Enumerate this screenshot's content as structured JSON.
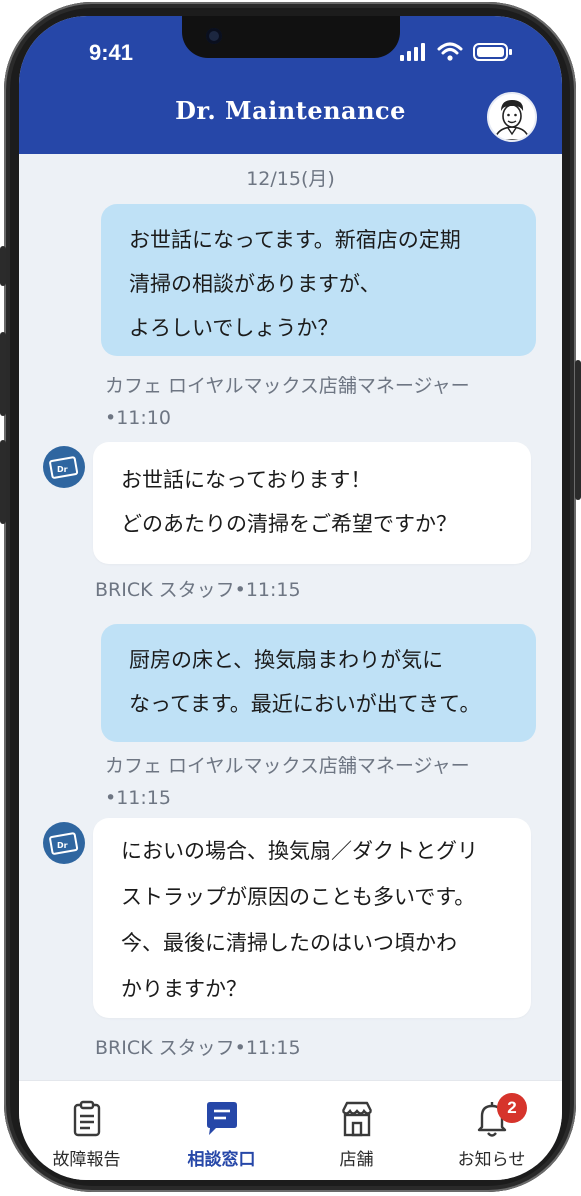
{
  "status_bar": {
    "time": "9:41"
  },
  "header": {
    "app_title": "Dr. Maintenance"
  },
  "chat": {
    "date": "12/15(月)",
    "messages": [
      {
        "direction": "out",
        "text": "お世話になってます。新宿店の定期\n清掃の相談がありますが、\nよろしいでしょうか？",
        "meta": "カフェ ロイヤルマックス店舗マネージャー\n•11:10"
      },
      {
        "direction": "in",
        "text": "お世話になっております！\nどのあたりの清掃をご希望ですか？",
        "meta": "BRICK スタッフ•11:15"
      },
      {
        "direction": "out",
        "text": "厨房の床と、換気扇まわりが気に\nなってます。最近においが出てきて。",
        "meta": "カフェ ロイヤルマックス店舗マネージャー\n•11:15"
      },
      {
        "direction": "in",
        "text": "においの場合、換気扇／ダクトとグリ\nストラップが原因のことも多いです。\n今、最後に清掃したのはいつ頃かわ\nかりますか？",
        "meta": "BRICK スタッフ•11:15"
      }
    ]
  },
  "tabbar": {
    "tabs": [
      {
        "label": "故障報告",
        "icon": "clipboard-icon",
        "active": false
      },
      {
        "label": "相談窓口",
        "icon": "chat-icon",
        "active": true
      },
      {
        "label": "店舗",
        "icon": "store-icon",
        "active": false
      },
      {
        "label": "お知らせ",
        "icon": "bell-icon",
        "active": false,
        "badge": "2"
      }
    ]
  },
  "colors": {
    "brand": "#2647a8",
    "outgoing_bubble": "#bfe1f6",
    "incoming_bubble": "#ffffff",
    "chat_background": "#edf1f6",
    "badge": "#d6342c"
  }
}
